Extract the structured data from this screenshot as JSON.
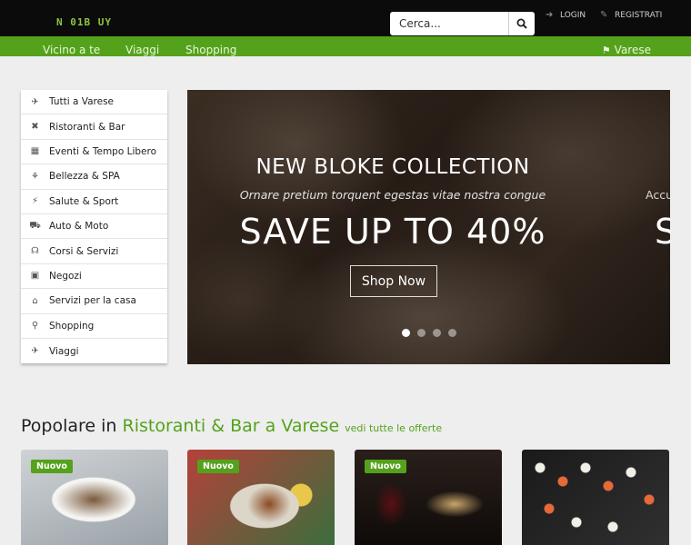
{
  "header": {
    "logo_text": "N 01B UY",
    "search": {
      "placeholder": "Cerca..."
    },
    "login_label": "LOGIN",
    "register_label": "REGISTRATI"
  },
  "nav": {
    "items": [
      "Vicino a te",
      "Viaggi",
      "Shopping"
    ],
    "location": "Varese"
  },
  "sidebar": {
    "items": [
      {
        "label": "Tutti a Varese",
        "icon": "plane-icon"
      },
      {
        "label": "Ristoranti & Bar",
        "icon": "cutlery-icon"
      },
      {
        "label": "Eventi & Tempo Libero",
        "icon": "calendar-icon"
      },
      {
        "label": "Bellezza & SPA",
        "icon": "spa-icon"
      },
      {
        "label": "Salute & Sport",
        "icon": "bolt-icon"
      },
      {
        "label": "Auto & Moto",
        "icon": "car-icon"
      },
      {
        "label": "Corsi & Servizi",
        "icon": "headphones-icon"
      },
      {
        "label": "Negozi",
        "icon": "briefcase-icon"
      },
      {
        "label": "Servizi per la casa",
        "icon": "home-icon"
      },
      {
        "label": "Shopping",
        "icon": "cart-icon"
      },
      {
        "label": "Viaggi",
        "icon": "plane-icon"
      }
    ]
  },
  "slider": {
    "title": "NEW BLOKE COLLECTION",
    "subtitle": "Ornare pretium torquent egestas vitae nostra congue",
    "headline": "SAVE UP TO 40%",
    "button": "Shop Now",
    "next_subtitle_fragment": "Accu",
    "next_headline_fragment": "S",
    "active_dot": 1,
    "dot_count": 4
  },
  "popular": {
    "prefix": "Popolare in",
    "category": "Ristoranti & Bar a Varese",
    "link": "vedi tutte le offerte",
    "badge": "Nuovo"
  },
  "colors": {
    "brand_green": "#54a21b",
    "topbar": "#0b0b0b"
  }
}
